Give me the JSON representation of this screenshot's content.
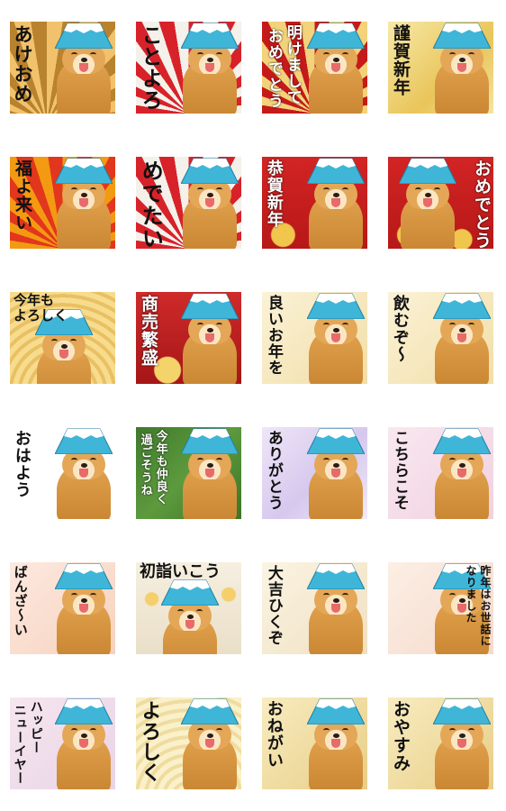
{
  "stickers": [
    {
      "text": "あけおめ"
    },
    {
      "text": "ことよろ"
    },
    {
      "text": "明けまして|おめでとう"
    },
    {
      "text": "謹賀新年"
    },
    {
      "text": "福よ来い"
    },
    {
      "text": "めでたい"
    },
    {
      "text": "恭賀新年"
    },
    {
      "text": "おめでとう"
    },
    {
      "text": "今年も|よろしく"
    },
    {
      "text": "商売繁盛"
    },
    {
      "text": "良いお年を"
    },
    {
      "text": "飲むぞ〜"
    },
    {
      "text": "おはよう"
    },
    {
      "text": "今年も仲良く|過ごそうね"
    },
    {
      "text": "ありがとう"
    },
    {
      "text": "こちらこそ"
    },
    {
      "text": "ばんざ〜い"
    },
    {
      "text": "初詣いこう"
    },
    {
      "text": "大吉ひくぞ"
    },
    {
      "text": "昨年はお世話に|なりました"
    },
    {
      "text": "ハッピー|ニューイヤー"
    },
    {
      "text": "よろしく"
    },
    {
      "text": "おねがい"
    },
    {
      "text": "おやすみ"
    }
  ]
}
